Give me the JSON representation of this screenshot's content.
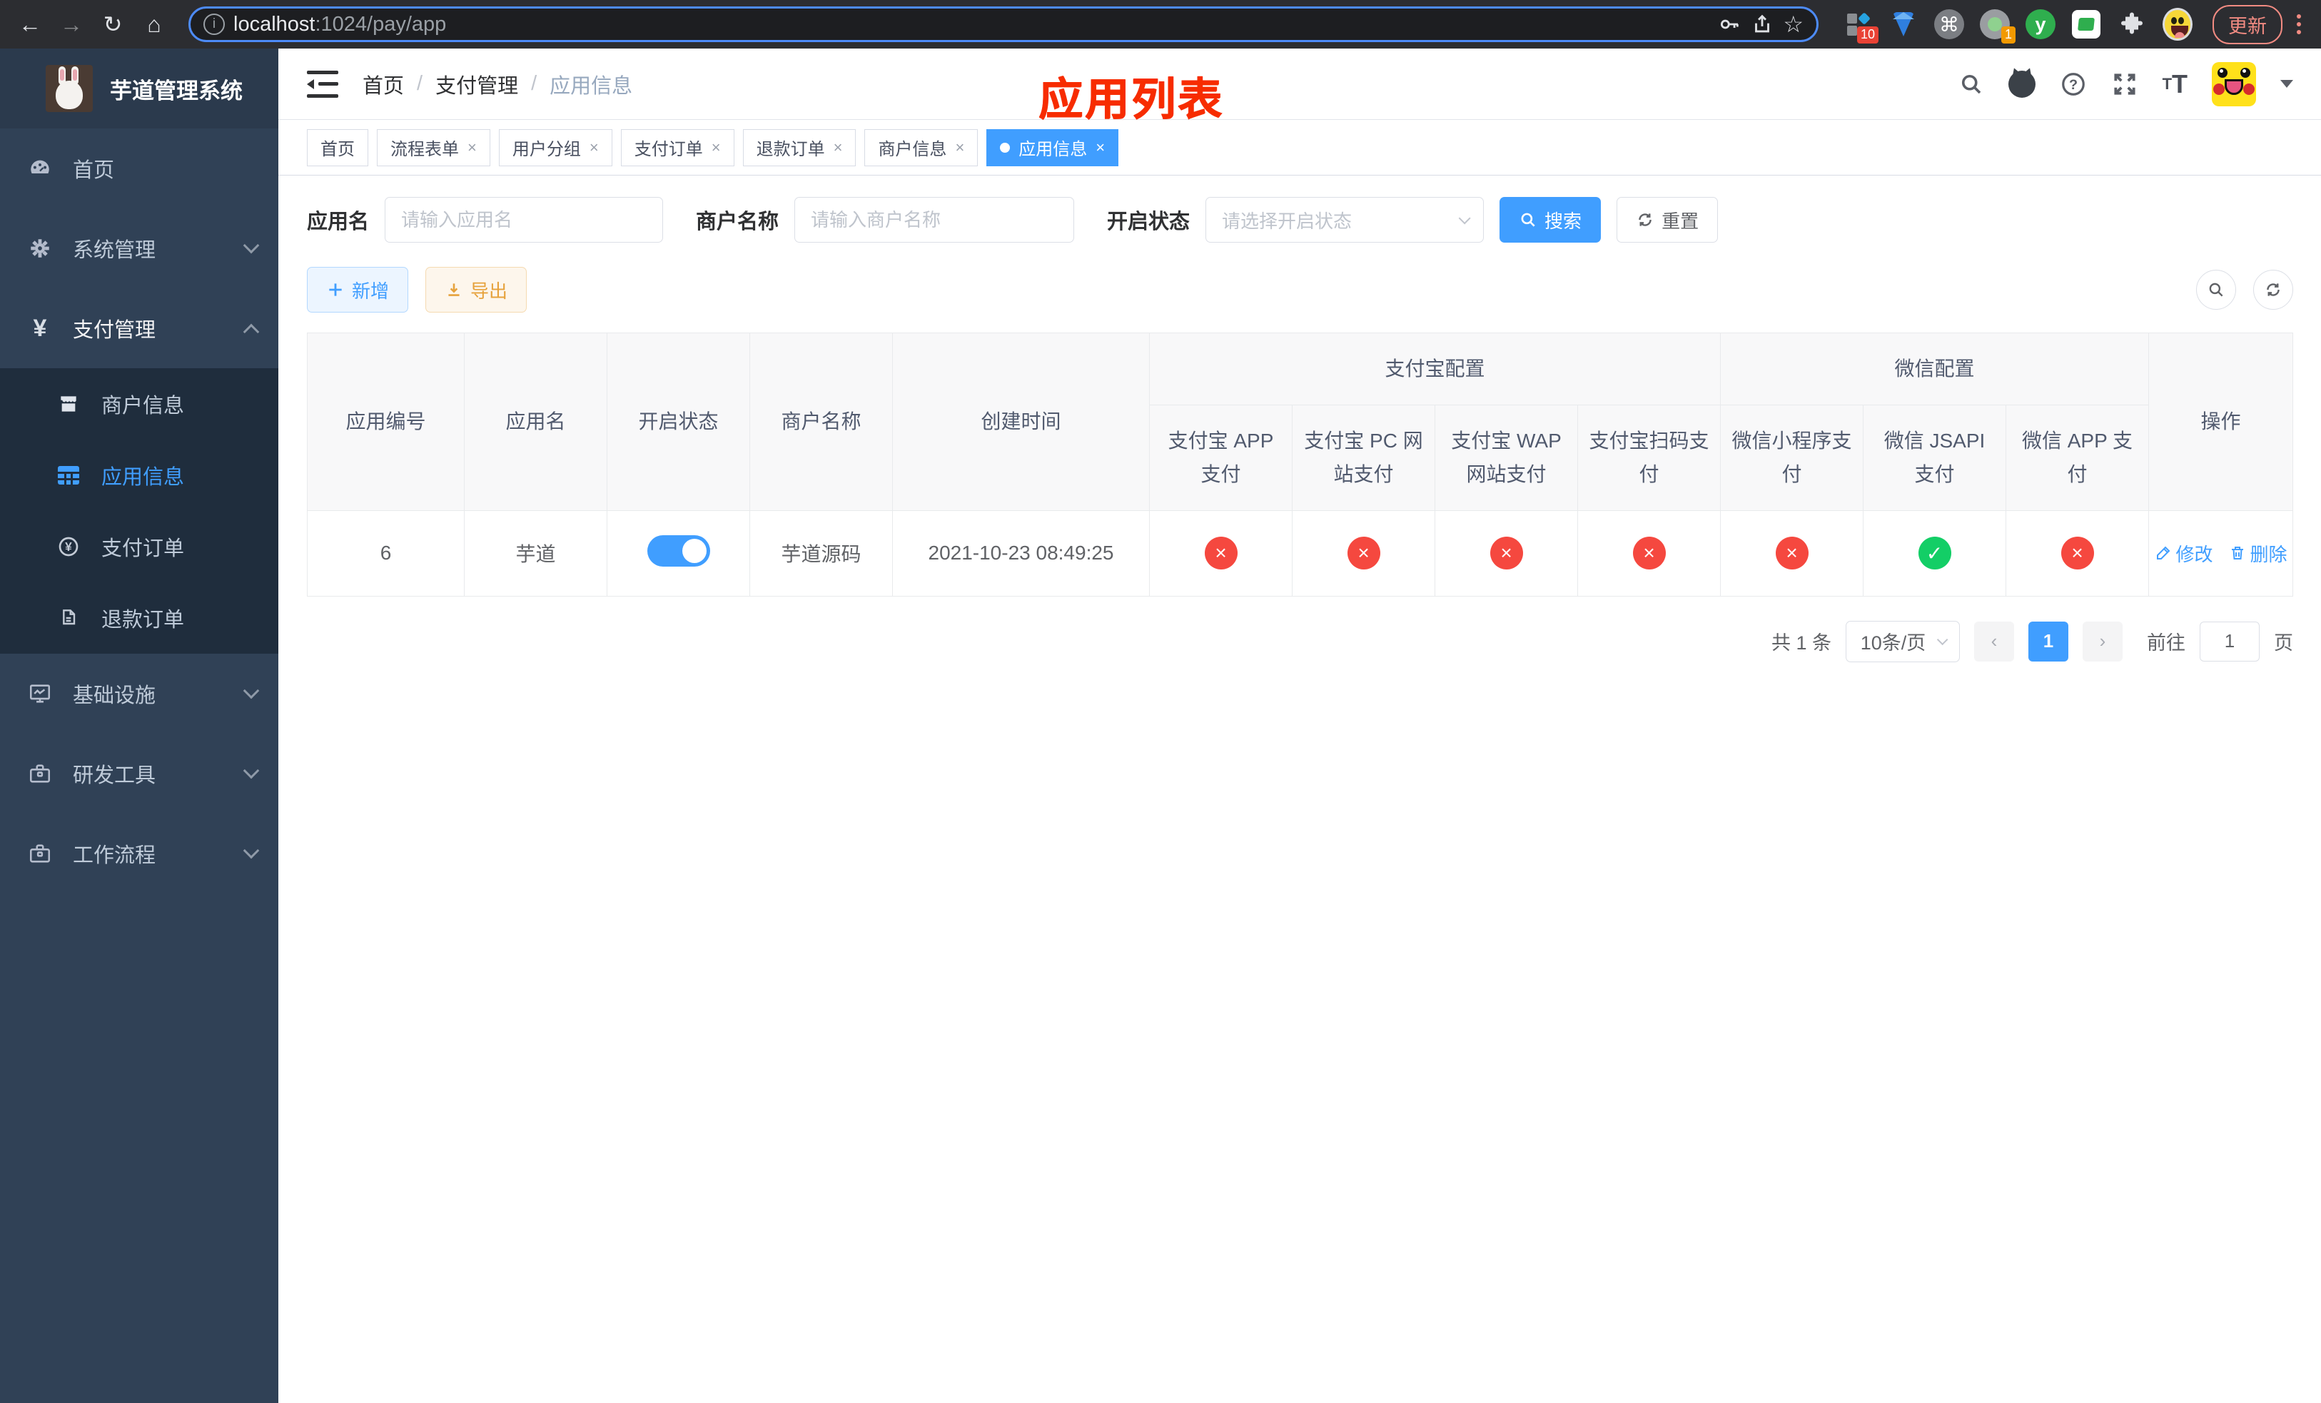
{
  "colors": {
    "accent": "#409eff",
    "success": "#13ce66",
    "danger": "#f5483f",
    "annotation": "#f72c00",
    "warning": "#e6a23c"
  },
  "browser": {
    "url_host": "localhost",
    "url_path": ":1024/pay/app",
    "update_label": "更新",
    "ext_badge_grid": "10",
    "ext_badge_proxy": "1",
    "ext_letter": "y"
  },
  "sidebar": {
    "title": "芋道管理系统",
    "items": [
      {
        "label": "首页"
      },
      {
        "label": "系统管理"
      },
      {
        "label": "支付管理"
      },
      {
        "label": "商户信息"
      },
      {
        "label": "应用信息"
      },
      {
        "label": "支付订单"
      },
      {
        "label": "退款订单"
      },
      {
        "label": "基础设施"
      },
      {
        "label": "研发工具"
      },
      {
        "label": "工作流程"
      }
    ]
  },
  "header": {
    "breadcrumb": {
      "home": "首页",
      "section": "支付管理",
      "current": "应用信息"
    },
    "annotation": "应用列表"
  },
  "tabs": [
    {
      "label": "首页"
    },
    {
      "label": "流程表单"
    },
    {
      "label": "用户分组"
    },
    {
      "label": "支付订单"
    },
    {
      "label": "退款订单"
    },
    {
      "label": "商户信息"
    },
    {
      "label": "应用信息"
    }
  ],
  "filters": {
    "app_name": {
      "label": "应用名",
      "placeholder": "请输入应用名"
    },
    "merchant_name": {
      "label": "商户名称",
      "placeholder": "请输入商户名称"
    },
    "status": {
      "label": "开启状态",
      "placeholder": "请选择开启状态"
    },
    "search_label": "搜索",
    "reset_label": "重置"
  },
  "toolbar": {
    "add_label": "新增",
    "export_label": "导出"
  },
  "table": {
    "headers": {
      "app_id": "应用编号",
      "app_name": "应用名",
      "status": "开启状态",
      "merchant": "商户名称",
      "created": "创建时间",
      "alipay_group": "支付宝配置",
      "wechat_group": "微信配置",
      "actions": "操作",
      "alipay_app": "支付宝 APP 支付",
      "alipay_pc": "支付宝 PC 网站支付",
      "alipay_wap": "支付宝 WAP 网站支付",
      "alipay_qr": "支付宝扫码支付",
      "wx_mini": "微信小程序支付",
      "wx_jsapi": "微信 JSAPI 支付",
      "wx_app": "微信 APP 支付"
    },
    "row": {
      "app_id": "6",
      "app_name": "芋道",
      "status": "on",
      "merchant": "芋道源码",
      "created": "2021-10-23 08:49:25",
      "configs": [
        "disabled",
        "disabled",
        "disabled",
        "disabled",
        "disabled",
        "enabled",
        "disabled"
      ],
      "edit_label": "修改",
      "delete_label": "删除"
    }
  },
  "icons": {
    "cross": "×",
    "check": "✓"
  },
  "pagination": {
    "total": "共 1 条",
    "page_size": "10条/页",
    "page": "1",
    "goto_prefix": "前往",
    "goto_suffix": "页",
    "goto_value": "1"
  }
}
